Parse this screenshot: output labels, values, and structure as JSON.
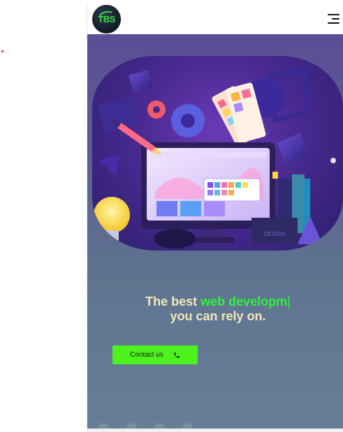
{
  "logo": {
    "text": "TBS",
    "brand_color": "#3fd43a"
  },
  "nav": {
    "menu_icon": "hamburger-menu-icon"
  },
  "hero": {
    "headline_part1": "The best ",
    "headline_highlight": "web developm",
    "headline_caret": "|",
    "headline_line2": "you can rely on.",
    "headline_color": "#efe9b8",
    "highlight_color": "#2ef23b",
    "illustration_label": "DESIGN",
    "contact_label": "Contact us",
    "contact_icon": "phone-icon",
    "button_color": "#4cf21c"
  },
  "carousel": {
    "dot_count": 4
  }
}
